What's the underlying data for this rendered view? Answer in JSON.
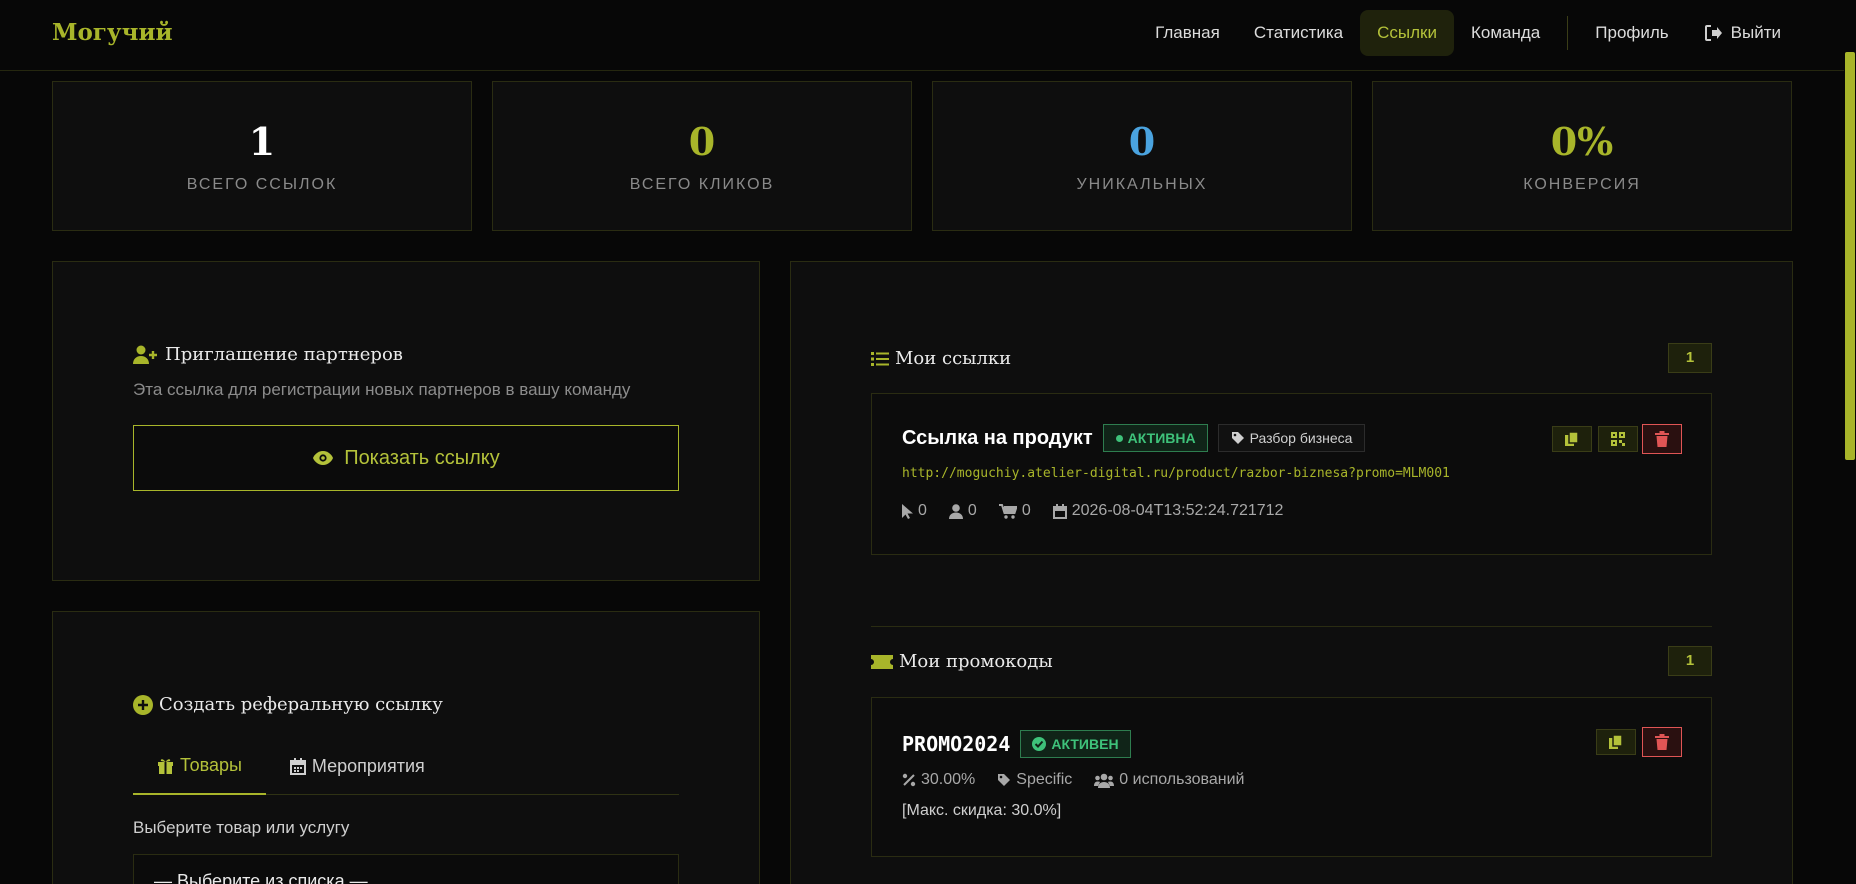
{
  "brand": "Могучий",
  "nav": {
    "home": "Главная",
    "stats": "Статистика",
    "links": "Ссылки",
    "team": "Команда",
    "profile": "Профиль",
    "logout": "Выйти"
  },
  "stats": [
    {
      "value": "1",
      "label": "ВСЕГО ССЫЛОК",
      "color": "#ffffff"
    },
    {
      "value": "0",
      "label": "ВСЕГО КЛИКОВ",
      "color": "#a8b52a"
    },
    {
      "value": "0",
      "label": "УНИКАЛЬНЫХ",
      "color": "#4aa3df"
    },
    {
      "value": "0%",
      "label": "КОНВЕРСИЯ",
      "color": "#a8b52a"
    }
  ],
  "invite": {
    "title": "Приглашение партнеров",
    "description": "Эта ссылка для регистрации новых партнеров в вашу команду",
    "button": "Показать ссылку"
  },
  "create": {
    "title": "Создать реферальную ссылку",
    "tabs": [
      "Товары",
      "Мероприятия"
    ],
    "select_label": "Выберите товар или услугу",
    "select_value": "— Выберите из списка —"
  },
  "my_links": {
    "title": "Мои ссылки",
    "count": "1",
    "items": [
      {
        "name": "Ссылка на продукт",
        "status": "АКТИВНА",
        "tag": "Разбор бизнеса",
        "url": "http://moguchiy.atelier-digital.ru/product/razbor-biznesa?promo=MLM001",
        "clicks": "0",
        "unique": "0",
        "orders": "0",
        "date": "2026-08-04T13:52:24.721712"
      }
    ]
  },
  "my_promos": {
    "title": "Мои промокоды",
    "count": "1",
    "items": [
      {
        "code": "PROMO2024",
        "status": "АКТИВЕН",
        "discount": "30.00%",
        "type": "Specific",
        "uses": "0 использований",
        "max_discount": "[Макс. скидка: 30.0%]"
      }
    ]
  },
  "colors": {
    "accent": "#a8b52a",
    "background": "#070707",
    "success": "#3ec27a",
    "danger": "#e05555"
  }
}
